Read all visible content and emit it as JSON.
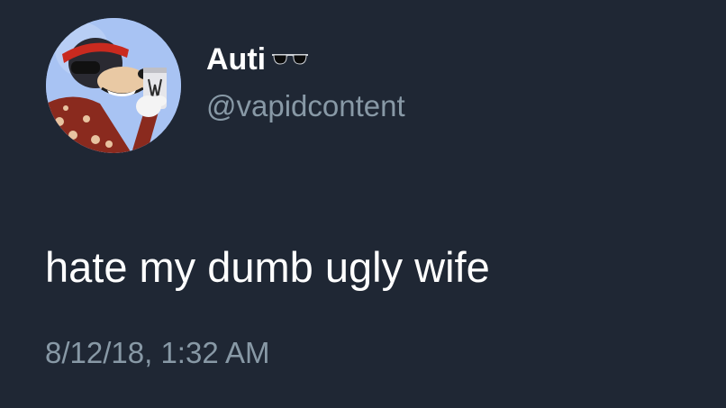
{
  "tweet": {
    "author": {
      "display_name": "Auti",
      "name_emoji": "sunglasses-icon",
      "handle": "@vapidcontent",
      "avatar": "cartoon-avatar-holding-can"
    },
    "text": "hate my dumb ugly wife",
    "timestamp": "8/12/18, 1:32 AM"
  },
  "colors": {
    "background": "#1f2734",
    "primary_text": "#ffffff",
    "secondary_text": "#8899a6"
  }
}
